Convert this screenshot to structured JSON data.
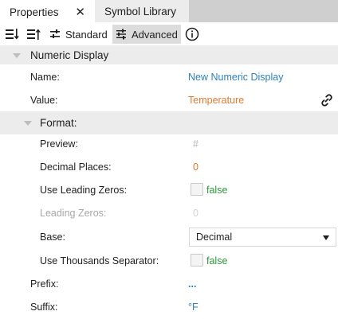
{
  "tabs": [
    {
      "label": "Properties",
      "close_glyph": "✕"
    },
    {
      "label": "Symbol Library"
    }
  ],
  "toolbar": {
    "sort_asc_icon": "sort-ascending-icon",
    "sort_desc_icon": "sort-descending-icon",
    "standard_label": "Standard",
    "advanced_label": "Advanced",
    "info_icon": "info-icon"
  },
  "section": {
    "title": "Numeric Display",
    "name_label": "Name:",
    "name_value": "New Numeric Display",
    "value_label": "Value:",
    "value_value": "Temperature"
  },
  "format": {
    "title": "Format:",
    "preview_label": "Preview:",
    "preview_value": "#",
    "decimal_places_label": "Decimal Places:",
    "decimal_places_value": "0",
    "use_leading_zeros_label": "Use Leading Zeros:",
    "use_leading_zeros_value": "false",
    "leading_zeros_label": "Leading Zeros:",
    "leading_zeros_value": "0",
    "base_label": "Base:",
    "base_value": "Decimal",
    "use_thousands_label": "Use Thousands Separator:",
    "use_thousands_value": "false"
  },
  "prefix": {
    "label": "Prefix:",
    "value": "..."
  },
  "suffix": {
    "label": "Suffix:",
    "value": "°F"
  },
  "colors": {
    "link_blue": "#2d7fc0",
    "value_orange": "#e07a2e",
    "bool_green": "#2a9a3a",
    "section_bg": "#ececec"
  }
}
